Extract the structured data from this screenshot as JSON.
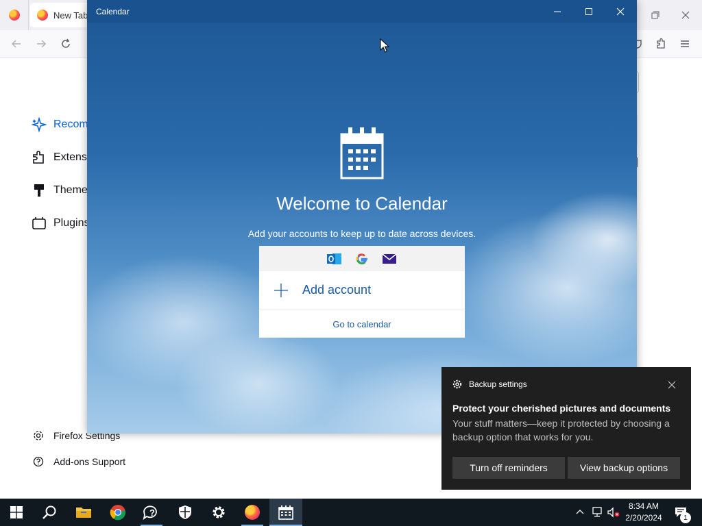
{
  "firefox": {
    "tab_newtab_label": "New Tab",
    "categories": [
      {
        "label": "Recom",
        "icon": "sparkle-icon"
      },
      {
        "label": "Extensi",
        "icon": "puzzle-icon"
      },
      {
        "label": "Theme",
        "icon": "brush-icon"
      },
      {
        "label": "Plugins",
        "icon": "plugin-icon"
      }
    ],
    "footer": {
      "settings_label": "Firefox Settings",
      "support_label": "Add-ons Support"
    },
    "accent_color": "#0061e0"
  },
  "calendar": {
    "window_title": "Calendar",
    "welcome_title": "Welcome to Calendar",
    "welcome_subtitle": "Add your accounts to keep up to date across devices.",
    "providers": [
      "outlook-icon",
      "google-icon",
      "mail-icon"
    ],
    "add_account_label": "Add account",
    "go_to_calendar_label": "Go to calendar",
    "titlebar_color": "#1a5290"
  },
  "toast": {
    "app_name": "Backup settings",
    "title": "Protect your cherished pictures and documents",
    "body": "Your stuff matters—keep it protected by choosing a backup option that works for you.",
    "button_turn_off": "Turn off reminders",
    "button_view": "View backup options"
  },
  "taskbar": {
    "apps": [
      "start-icon",
      "search-icon",
      "file-explorer-icon",
      "chrome-icon",
      "help-icon",
      "security-icon",
      "settings-icon",
      "firefox-icon",
      "calendar-icon"
    ],
    "clock_time": "8:34 AM",
    "clock_date": "2/20/2024",
    "notification_count": "1"
  }
}
